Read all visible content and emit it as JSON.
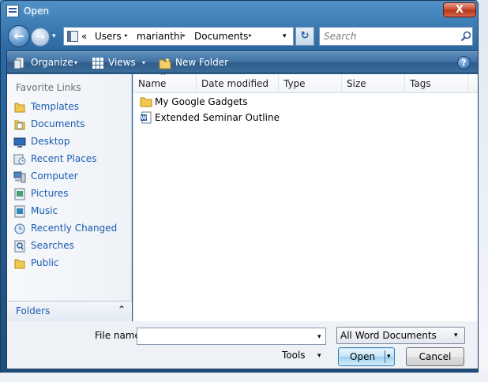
{
  "window": {
    "title": "Open",
    "close_glyph": "X"
  },
  "nav": {
    "back_glyph": "←",
    "forward_glyph": "→",
    "history_dropdown_glyph": "▾",
    "address": {
      "overflow": "«",
      "segments": [
        "Users",
        "marianthi",
        "Documents"
      ],
      "separator": "▸",
      "dropdown_glyph": "▾"
    },
    "refresh_glyph": "↻",
    "search_placeholder": "Search"
  },
  "toolbar": {
    "organize_label": "Organize",
    "views_label": "Views",
    "new_folder_label": "New Folder",
    "dropdown_glyph": "▾",
    "help_glyph": "?"
  },
  "sidebar": {
    "title": "Favorite Links",
    "items": [
      {
        "label": "Templates",
        "icon": "folder-icon"
      },
      {
        "label": "Documents",
        "icon": "documents-icon"
      },
      {
        "label": "Desktop",
        "icon": "desktop-icon"
      },
      {
        "label": "Recent Places",
        "icon": "recent-places-icon"
      },
      {
        "label": "Computer",
        "icon": "computer-icon"
      },
      {
        "label": "Pictures",
        "icon": "pictures-icon"
      },
      {
        "label": "Music",
        "icon": "music-icon"
      },
      {
        "label": "Recently Changed",
        "icon": "recently-changed-icon"
      },
      {
        "label": "Searches",
        "icon": "searches-icon"
      },
      {
        "label": "Public",
        "icon": "folder-icon"
      }
    ],
    "folders_label": "Folders",
    "folders_chevron": "⌃"
  },
  "filelist": {
    "columns": [
      "Name",
      "Date modified",
      "Type",
      "Size",
      "Tags"
    ],
    "sort_caret": "^",
    "rows": [
      {
        "name": "My Google Gadgets",
        "icon": "folder-icon"
      },
      {
        "name": "Extended Seminar Outline",
        "icon": "word-document-icon"
      }
    ]
  },
  "footer": {
    "file_name_label": "File name:",
    "file_name_value": "",
    "file_name_dropdown": "▾",
    "file_type": "All Word Documents",
    "file_type_dropdown": "▾",
    "tools_label": "Tools",
    "tools_dropdown": "▾",
    "open_label": "Open",
    "open_dropdown": "▾",
    "cancel_label": "Cancel"
  },
  "colors": {
    "link_blue": "#1a5cb0",
    "title_bar": "#3d7db6",
    "toolbar": "#3e6f9f"
  }
}
